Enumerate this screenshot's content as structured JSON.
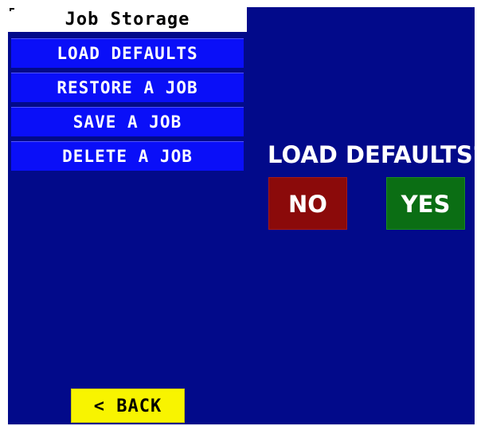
{
  "window": {
    "title": "Job Storage"
  },
  "menu": {
    "items": [
      {
        "label": "LOAD DEFAULTS"
      },
      {
        "label": "RESTORE A JOB"
      },
      {
        "label": "SAVE A JOB"
      },
      {
        "label": "DELETE A JOB"
      }
    ]
  },
  "dialog": {
    "prompt": "LOAD DEFAULTS?",
    "no_label": "NO",
    "yes_label": "YES"
  },
  "footer": {
    "back_label": "< BACK"
  },
  "colors": {
    "screen_background": "#020a8a",
    "menu_item": "#0a0ff8",
    "no_button": "#8b0a0a",
    "yes_button": "#0b6e14",
    "back_button": "#f8f400"
  }
}
